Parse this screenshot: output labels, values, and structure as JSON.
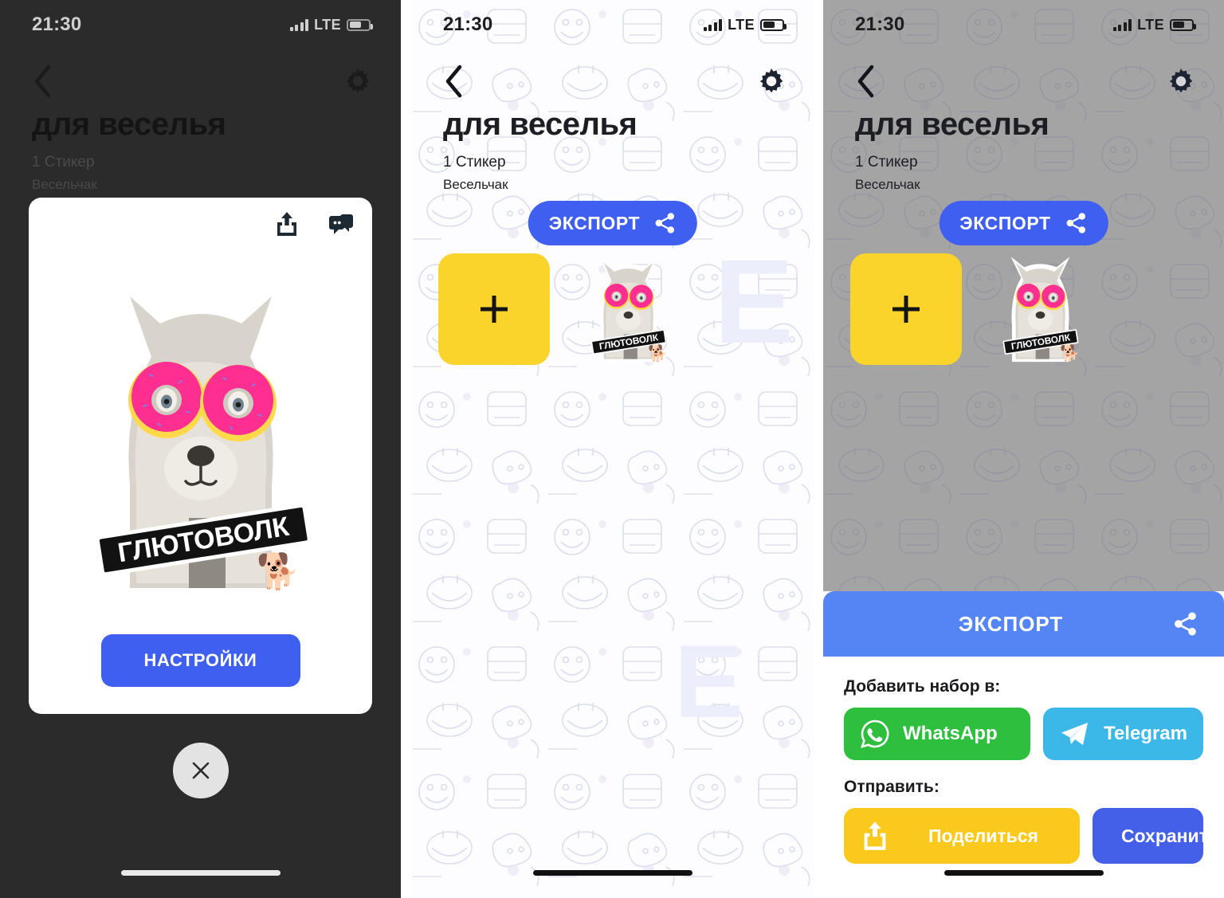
{
  "app": {
    "screens": [
      {
        "id": "sticker-detail",
        "theme": "dark-overlay",
        "status": {
          "time": "21:30",
          "network": "LTE",
          "signal_icon": "signal-bars-icon",
          "battery_icon": "battery-icon"
        },
        "nav": {
          "back_icon": "chevron-left-icon",
          "settings_icon": "gear-icon"
        },
        "title": "для веселья",
        "sticker_count": "1 Стикер",
        "author": "Весельчак",
        "card": {
          "share_icon": "share-upload-icon",
          "sticker_chat_icon": "sticker-chat-icon",
          "sticker_label": "ГЛЮТОВОЛК",
          "sticker_emoji": "🐕",
          "settings_button": "НАСТРОЙКИ"
        },
        "close_icon": "close-icon"
      },
      {
        "id": "sticker-pack-grid",
        "theme": "light",
        "status": {
          "time": "21:30",
          "network": "LTE",
          "signal_icon": "signal-bars-icon",
          "battery_icon": "battery-icon"
        },
        "nav": {
          "back_icon": "chevron-left-icon",
          "settings_icon": "gear-icon"
        },
        "title": "для веселья",
        "sticker_count": "1 Стикер",
        "author": "Весельчак",
        "export_button": {
          "label": "ЭКСПОРТ",
          "icon": "share-nodes-icon"
        },
        "tiles": [
          {
            "type": "add",
            "icon": "plus-icon"
          },
          {
            "type": "sticker",
            "label": "ГЛЮТОВОЛК",
            "emoji": "🐕"
          }
        ]
      },
      {
        "id": "export-sheet",
        "theme": "light-dimmed",
        "status": {
          "time": "21:30",
          "network": "LTE",
          "signal_icon": "signal-bars-icon",
          "battery_icon": "battery-icon"
        },
        "nav": {
          "back_icon": "chevron-left-icon",
          "settings_icon": "gear-icon"
        },
        "title": "для веселья",
        "sticker_count": "1 Стикер",
        "author": "Весельчак",
        "export_button": {
          "label": "ЭКСПОРТ",
          "icon": "share-nodes-icon"
        },
        "tiles": [
          {
            "type": "add",
            "icon": "plus-icon"
          },
          {
            "type": "sticker",
            "label": "ГЛЮТОВОЛК",
            "emoji": "🐕"
          }
        ],
        "sheet": {
          "header": {
            "label": "ЭКСПОРТ",
            "icon": "share-nodes-icon"
          },
          "add_to_label": "Добавить набор в:",
          "add_to_buttons": [
            {
              "label": "WhatsApp",
              "icon": "whatsapp-icon",
              "color": "#2fbf3f"
            },
            {
              "label": "Telegram",
              "icon": "telegram-icon",
              "color": "#3bb8e8"
            }
          ],
          "send_label": "Отправить:",
          "send_buttons": [
            {
              "label": "Поделиться",
              "icon": "share-upload-icon",
              "color": "#fbc91b"
            },
            {
              "label": "Сохранить",
              "icon": "photos-icon",
              "color": "#4560e8"
            }
          ]
        }
      }
    ],
    "colors": {
      "accent_blue": "#3f5ff0",
      "sheet_blue": "#5585f5",
      "tile_yellow": "#fad42a",
      "share_yellow": "#fbc91b",
      "whatsapp_green": "#2fbf3f",
      "telegram_cyan": "#3bb8e8",
      "photos_blue": "#4560e8",
      "dark_overlay": "#2b2b2b"
    }
  }
}
